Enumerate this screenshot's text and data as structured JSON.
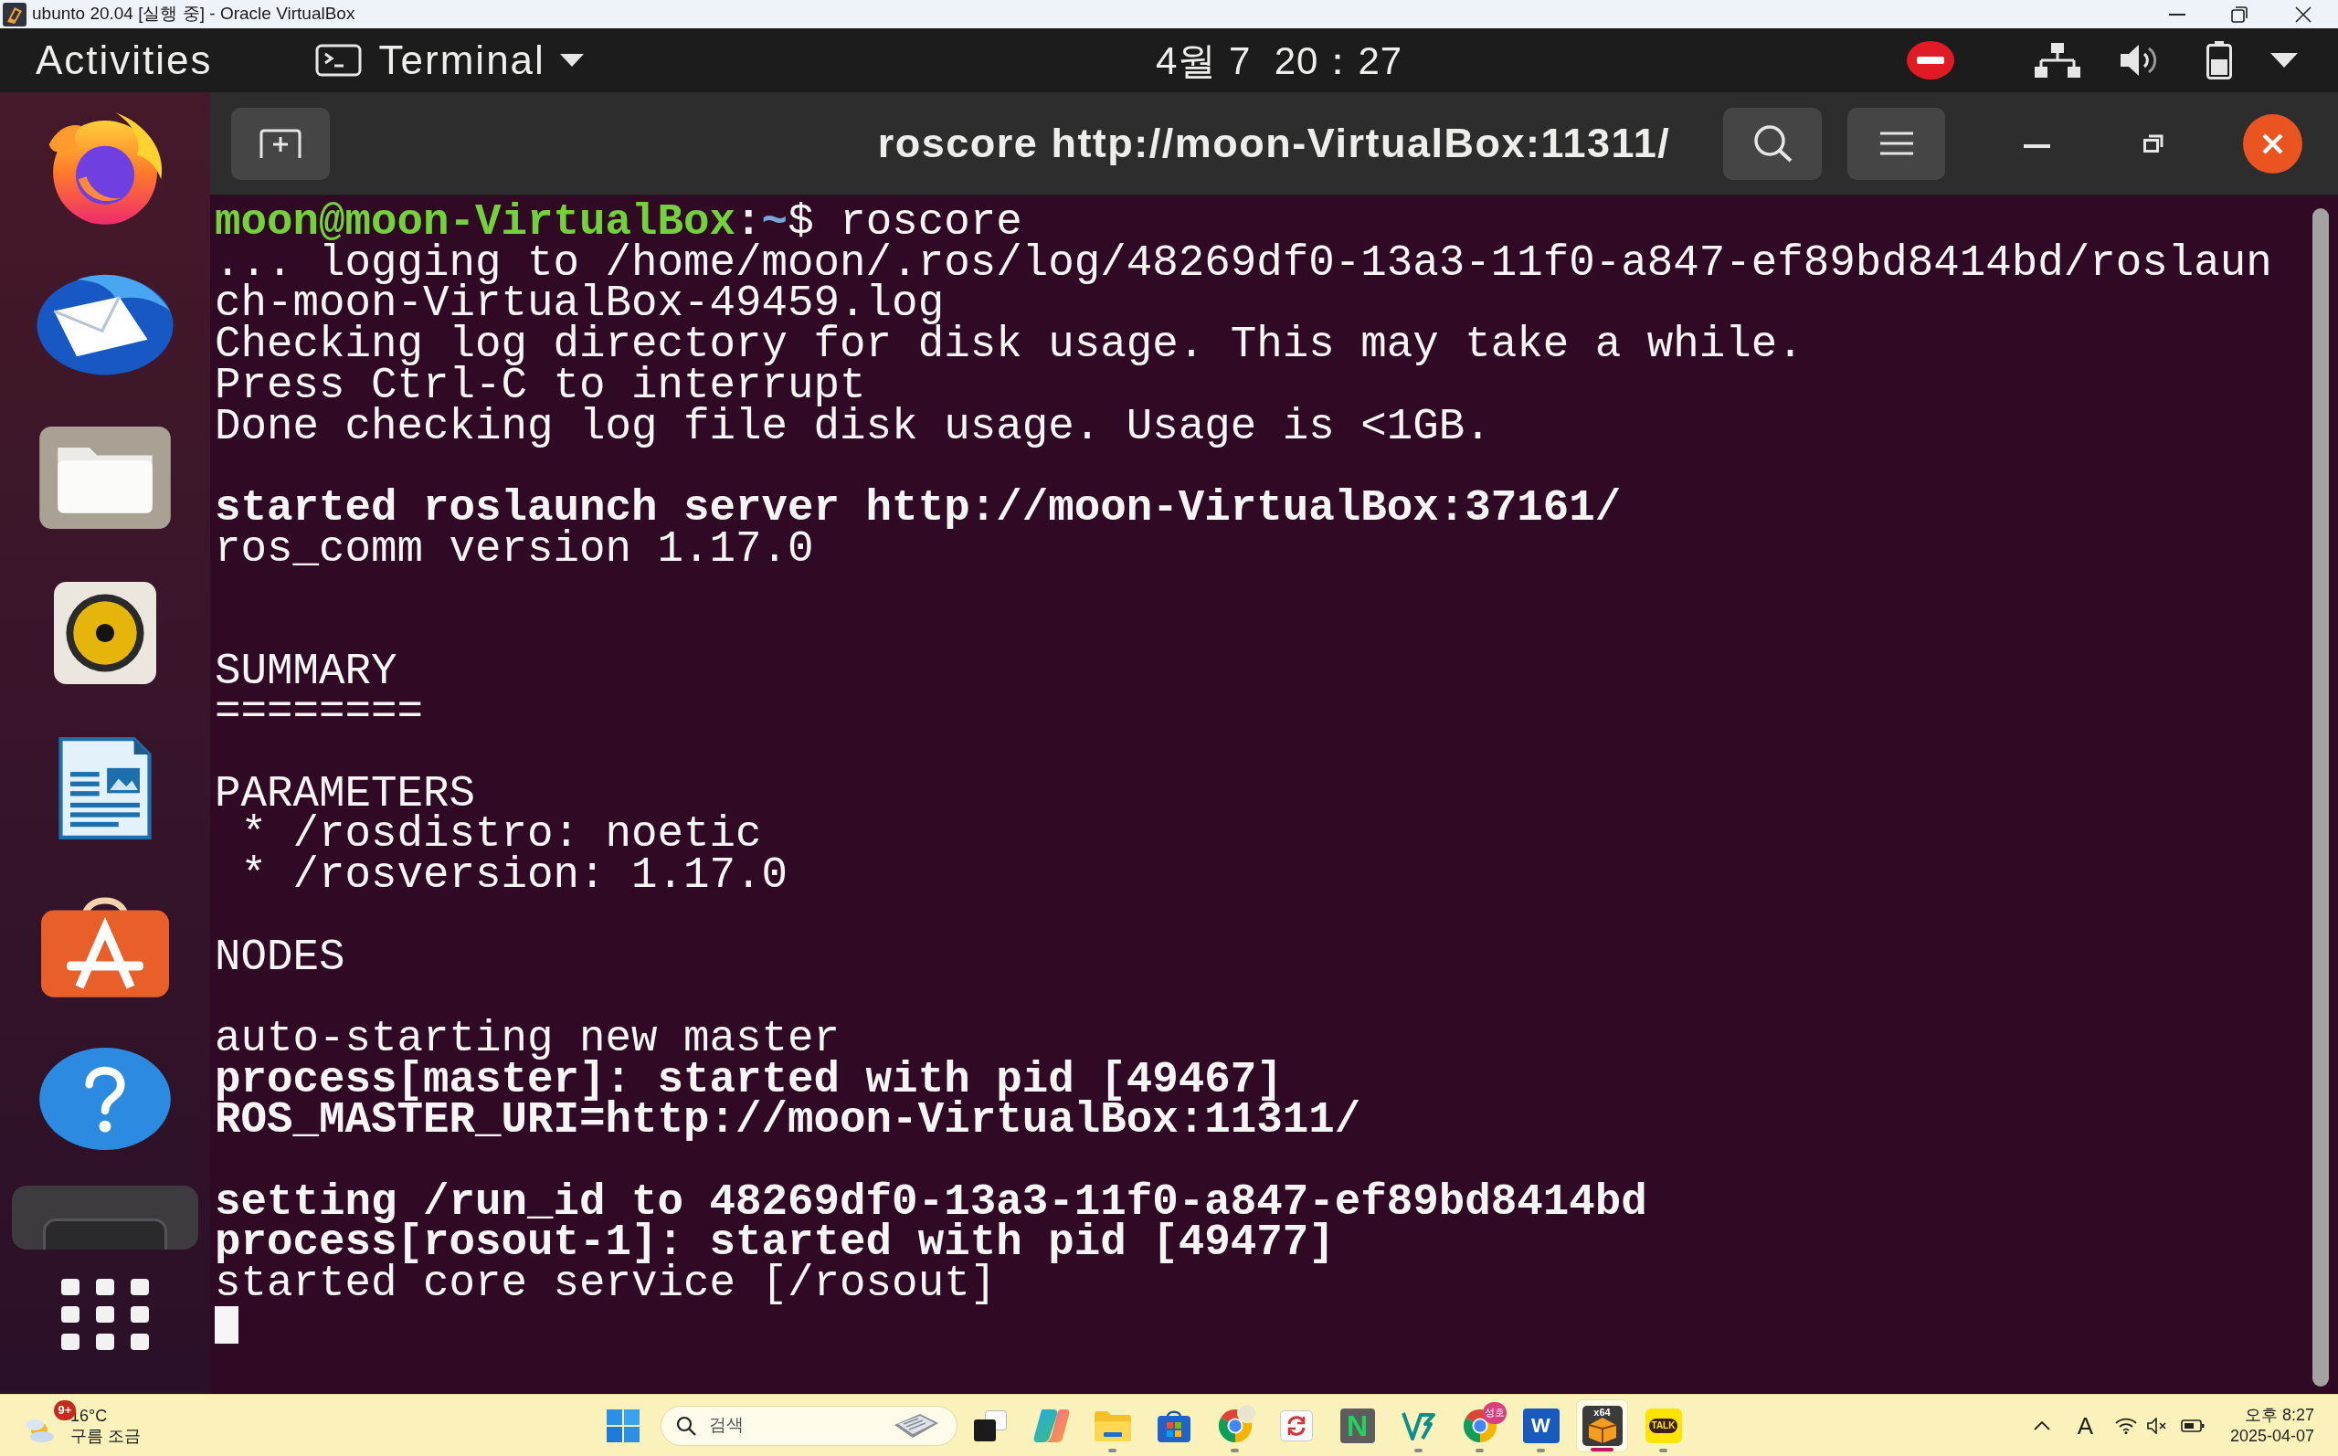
{
  "host_window": {
    "title": "ubunto 20.04 [실행 중] - Oracle VirtualBox"
  },
  "top_bar": {
    "activities": "Activities",
    "app_menu": "Terminal",
    "clock": "4월 7  20：27"
  },
  "dock": {
    "items": [
      {
        "kind": "browser",
        "active": false
      },
      {
        "kind": "mail",
        "active": false
      },
      {
        "kind": "files",
        "active": false
      },
      {
        "kind": "audio",
        "active": false
      },
      {
        "kind": "document",
        "active": false
      },
      {
        "kind": "store",
        "active": false
      },
      {
        "kind": "help",
        "active": false
      },
      {
        "kind": "terminal",
        "active": true
      }
    ]
  },
  "terminal": {
    "title": "roscore http://moon-VirtualBox:11311/",
    "cursor": true,
    "lines": [
      {
        "kind": "prompt",
        "user_host": "moon@moon-VirtualBox",
        "separator": ":",
        "path": "~",
        "symbol": "$",
        "command": "roscore"
      },
      {
        "kind": "text",
        "text": "... logging to /home/moon/.ros/log/48269df0-13a3-11f0-a847-ef89bd8414bd/roslaun"
      },
      {
        "kind": "text",
        "text": "ch-moon-VirtualBox-49459.log"
      },
      {
        "kind": "text",
        "text": "Checking log directory for disk usage. This may take a while."
      },
      {
        "kind": "text",
        "text": "Press Ctrl-C to interrupt"
      },
      {
        "kind": "text",
        "text": "Done checking log file disk usage. Usage is <1GB."
      },
      {
        "kind": "blank"
      },
      {
        "kind": "bold",
        "text": "started roslaunch server http://moon-VirtualBox:37161/"
      },
      {
        "kind": "text",
        "text": "ros_comm version 1.17.0"
      },
      {
        "kind": "blank"
      },
      {
        "kind": "blank"
      },
      {
        "kind": "text",
        "text": "SUMMARY"
      },
      {
        "kind": "text",
        "text": "========"
      },
      {
        "kind": "blank"
      },
      {
        "kind": "text",
        "text": "PARAMETERS"
      },
      {
        "kind": "text",
        "text": " * /rosdistro: noetic"
      },
      {
        "kind": "text",
        "text": " * /rosversion: 1.17.0"
      },
      {
        "kind": "blank"
      },
      {
        "kind": "text",
        "text": "NODES"
      },
      {
        "kind": "blank"
      },
      {
        "kind": "text",
        "text": "auto-starting new master"
      },
      {
        "kind": "bold",
        "text": "process[master]: started with pid [49467]"
      },
      {
        "kind": "bold",
        "text": "ROS_MASTER_URI=http://moon-VirtualBox:11311/"
      },
      {
        "kind": "blank"
      },
      {
        "kind": "bold",
        "text": "setting /run_id to 48269df0-13a3-11f0-a847-ef89bd8414bd"
      },
      {
        "kind": "bold",
        "text": "process[rosout-1]: started with pid [49477]"
      },
      {
        "kind": "text",
        "text": "started core service [/rosout]"
      }
    ]
  },
  "taskbar": {
    "weather": {
      "badge": "9+",
      "temperature": "16°C",
      "condition": "구름 조금"
    },
    "search": {
      "placeholder": "검색"
    },
    "apps": [
      {
        "kind": "taskview",
        "running": false,
        "active": false
      },
      {
        "kind": "copilot",
        "running": false,
        "active": false
      },
      {
        "kind": "explorer",
        "running": true,
        "active": false
      },
      {
        "kind": "store",
        "running": false,
        "active": false
      },
      {
        "kind": "chrome",
        "running": true,
        "active": false,
        "avatar": true
      },
      {
        "kind": "sync",
        "running": false,
        "active": false
      },
      {
        "kind": "naver",
        "label": "N",
        "running": false,
        "active": false
      },
      {
        "kind": "v3",
        "running": true,
        "active": false
      },
      {
        "kind": "chrome",
        "running": true,
        "active": false,
        "badge": "성호"
      },
      {
        "kind": "word",
        "label": "W",
        "running": true,
        "active": false
      },
      {
        "kind": "virtualbox",
        "label": "x64",
        "running": true,
        "active": true
      },
      {
        "kind": "kakao",
        "label": "TALK",
        "running": true,
        "active": false
      }
    ],
    "tray": {
      "ime": "A",
      "time": "오후 8:27",
      "date": "2025-04-07"
    }
  }
}
